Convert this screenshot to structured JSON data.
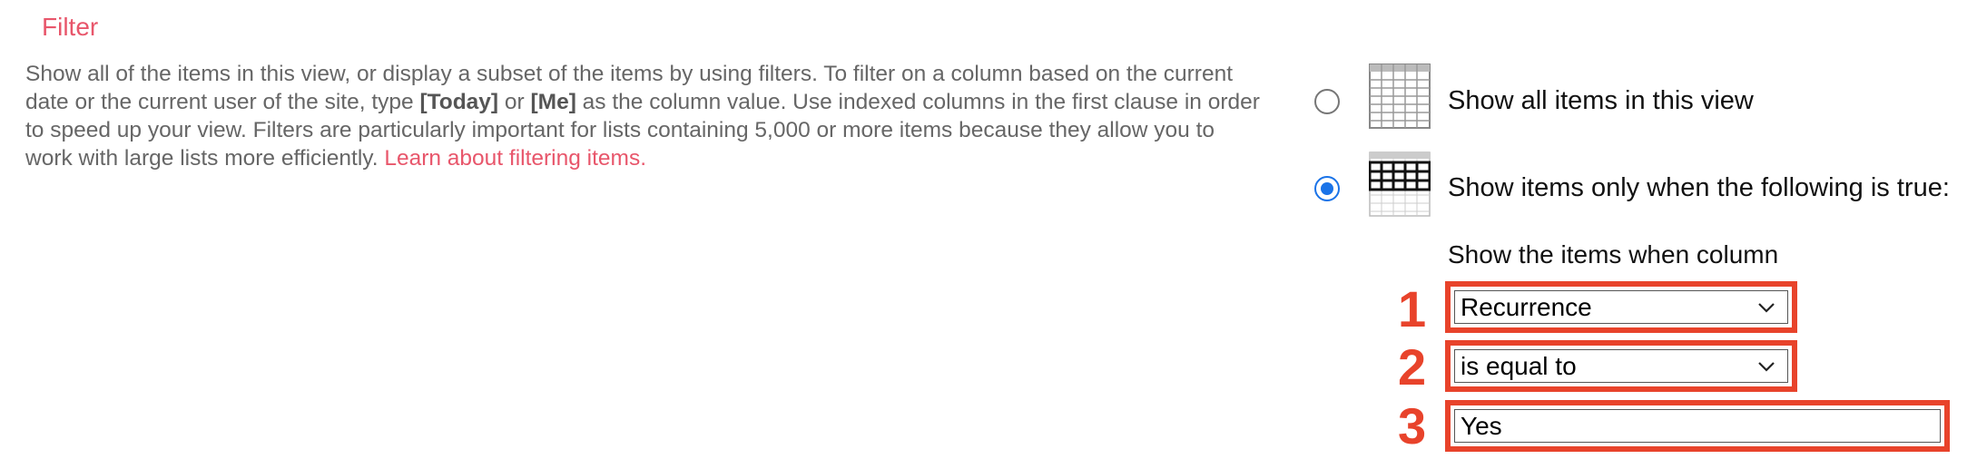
{
  "section": {
    "heading": "Filter",
    "description": {
      "part1": "Show all of the items in this view, or display a subset of the items by using filters. To filter on a column based on the current date or the current user of the site, type ",
      "today_token": "[Today]",
      "or_text": " or ",
      "me_token": "[Me]",
      "part2": " as the column value. Use indexed columns in the first clause in order to speed up your view. Filters are particularly important for lists containing 5,000 or more items because they allow you to work with large lists more efficiently. ",
      "link_text": "Learn about filtering items."
    }
  },
  "options": {
    "show_all_label": "Show all items in this view",
    "show_filtered_label": "Show items only when the following is true:",
    "selected": "show_filtered"
  },
  "filter": {
    "caption": "Show the items when column",
    "column_value": "Recurrence",
    "operator_value": "is equal to",
    "value_input": "Yes"
  },
  "markers": {
    "step1": "1",
    "step2": "2",
    "step3": "3"
  },
  "colors": {
    "accent": "#e8566b",
    "highlight_red": "#e8432b",
    "radio_blue": "#1a73e8"
  },
  "icons": {
    "all_items": "table-grid-icon",
    "filtered_items": "table-filtered-icon",
    "dropdown": "chevron-down-icon"
  }
}
